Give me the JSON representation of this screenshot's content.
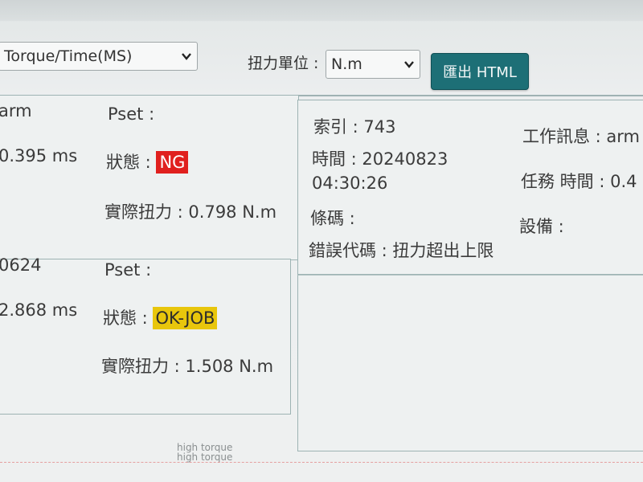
{
  "toolbar": {
    "chart_select_value": "Torque/Time(MS)",
    "unit_label": "扭力單位 :",
    "unit_select_value": "N.m",
    "export_button": "匯出 HTML"
  },
  "records": [
    {
      "left_partial_1": "arm",
      "left_partial_2": "0.395 ms",
      "pset_label": "Pset :",
      "status_label": "狀態 :",
      "status_value": "NG",
      "torque_text": "實際扭力 : 0.798 N.m"
    },
    {
      "left_partial_1": "0624",
      "left_partial_2": "2.868 ms",
      "pset_label": "Pset :",
      "status_label": "狀態 :",
      "status_value": "OK-JOB",
      "torque_text": "實際扭力 : 1.508 N.m"
    }
  ],
  "detail": {
    "index_text": "索引 : 743",
    "time_text": "時間 : 20240823",
    "time_text_2": "04:30:26",
    "barcode_text": "條碼 :",
    "error_text": "錯誤代碼 : 扭力超出上限",
    "work_info_text": "工作訊息 : arm",
    "task_time_text": "任務 時間 : 0.4",
    "device_text": "設備 :"
  },
  "footer": {
    "hint_1": "high torque",
    "hint_2": "high torque"
  }
}
